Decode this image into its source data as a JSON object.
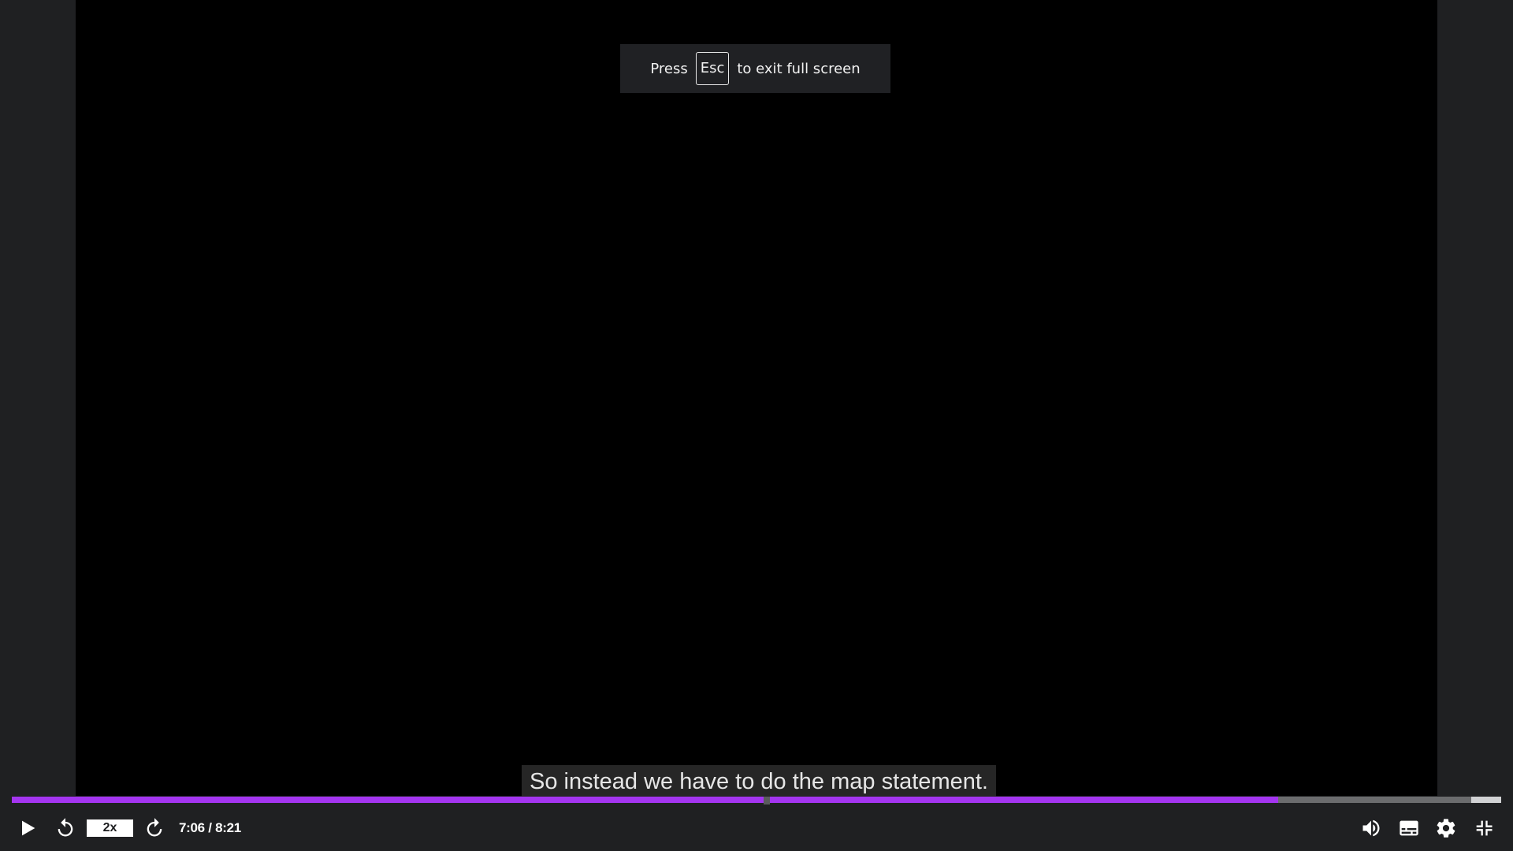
{
  "fullscreen_notice": {
    "prefix": "Press",
    "key": "Esc",
    "suffix": "to exit full screen"
  },
  "caption": {
    "text": "So instead we have to do the map statement."
  },
  "player": {
    "current_time": "7:06",
    "duration": "8:21",
    "time_display": "7:06 / 8:21",
    "speed_label": "2x",
    "progress_played_fraction": 0.85,
    "progress_buffered_fraction": 0.98,
    "accent_color": "#a435f0"
  },
  "icons": {
    "play": "play-icon",
    "rewind": "rewind-5s-icon",
    "forward": "forward-5s-icon",
    "volume": "volume-icon",
    "captions": "captions-icon",
    "settings": "gear-icon",
    "exit_fullscreen": "exit-fullscreen-icon"
  }
}
